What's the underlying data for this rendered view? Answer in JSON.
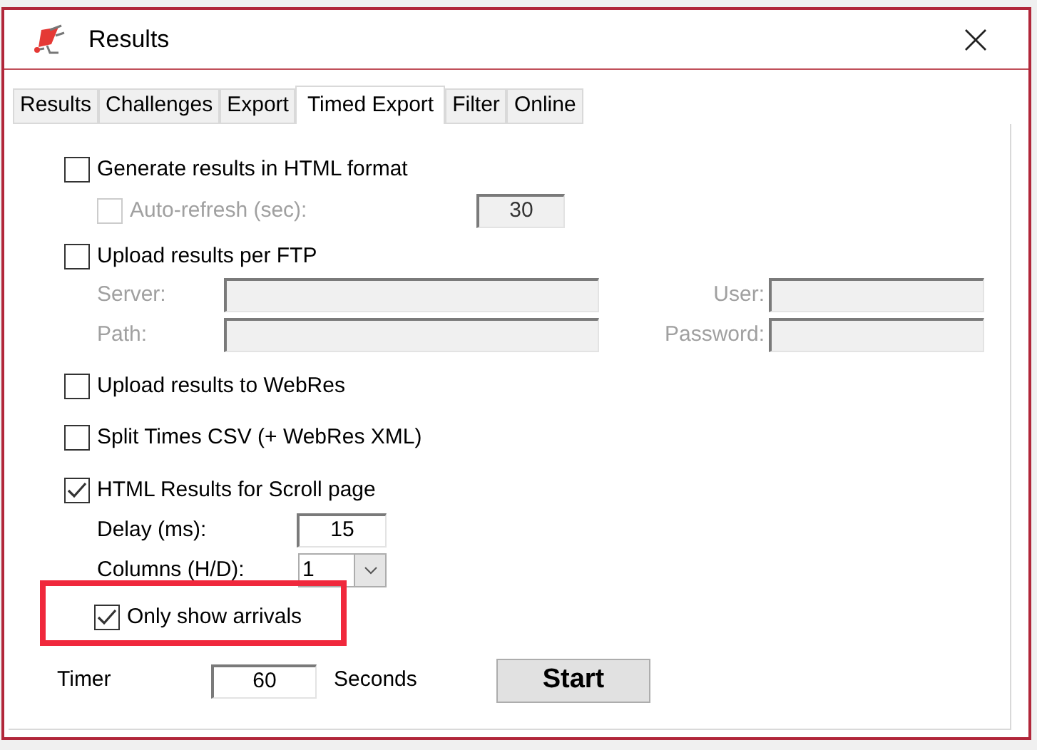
{
  "window": {
    "title": "Results"
  },
  "tabs": [
    {
      "label": "Results",
      "selected": false
    },
    {
      "label": "Challenges",
      "selected": false
    },
    {
      "label": "Export",
      "selected": false
    },
    {
      "label": "Timed Export",
      "selected": true
    },
    {
      "label": "Filter",
      "selected": false
    },
    {
      "label": "Online",
      "selected": false
    }
  ],
  "html_export": {
    "label": "Generate results in HTML format",
    "checked": false,
    "auto_refresh": {
      "label": "Auto-refresh (sec):",
      "checked": false,
      "disabled": true,
      "value": "30"
    }
  },
  "ftp_upload": {
    "label": "Upload results per FTP",
    "checked": false,
    "fields": [
      {
        "label": "Server:",
        "disabled": true
      },
      {
        "label": "User:",
        "disabled": true
      },
      {
        "label": "Path:",
        "disabled": true
      },
      {
        "label": "Password:",
        "disabled": true
      }
    ]
  },
  "webres_upload": {
    "label": "Upload results to WebRes",
    "checked": false
  },
  "split_times": {
    "label": "Split Times CSV (+ WebRes XML)",
    "checked": false
  },
  "scroll_page": {
    "label": "HTML Results for Scroll page",
    "checked": true,
    "delay": {
      "label": "Delay (ms):",
      "value": "15"
    },
    "columns": {
      "label": "Columns (H/D):",
      "value": "1"
    },
    "arrivals": {
      "label": "Only show arrivals",
      "checked": true,
      "highlighted": true
    }
  },
  "timer": {
    "label": "Timer",
    "value": "60",
    "unit": "Seconds"
  },
  "start_button": {
    "label": "Start"
  }
}
